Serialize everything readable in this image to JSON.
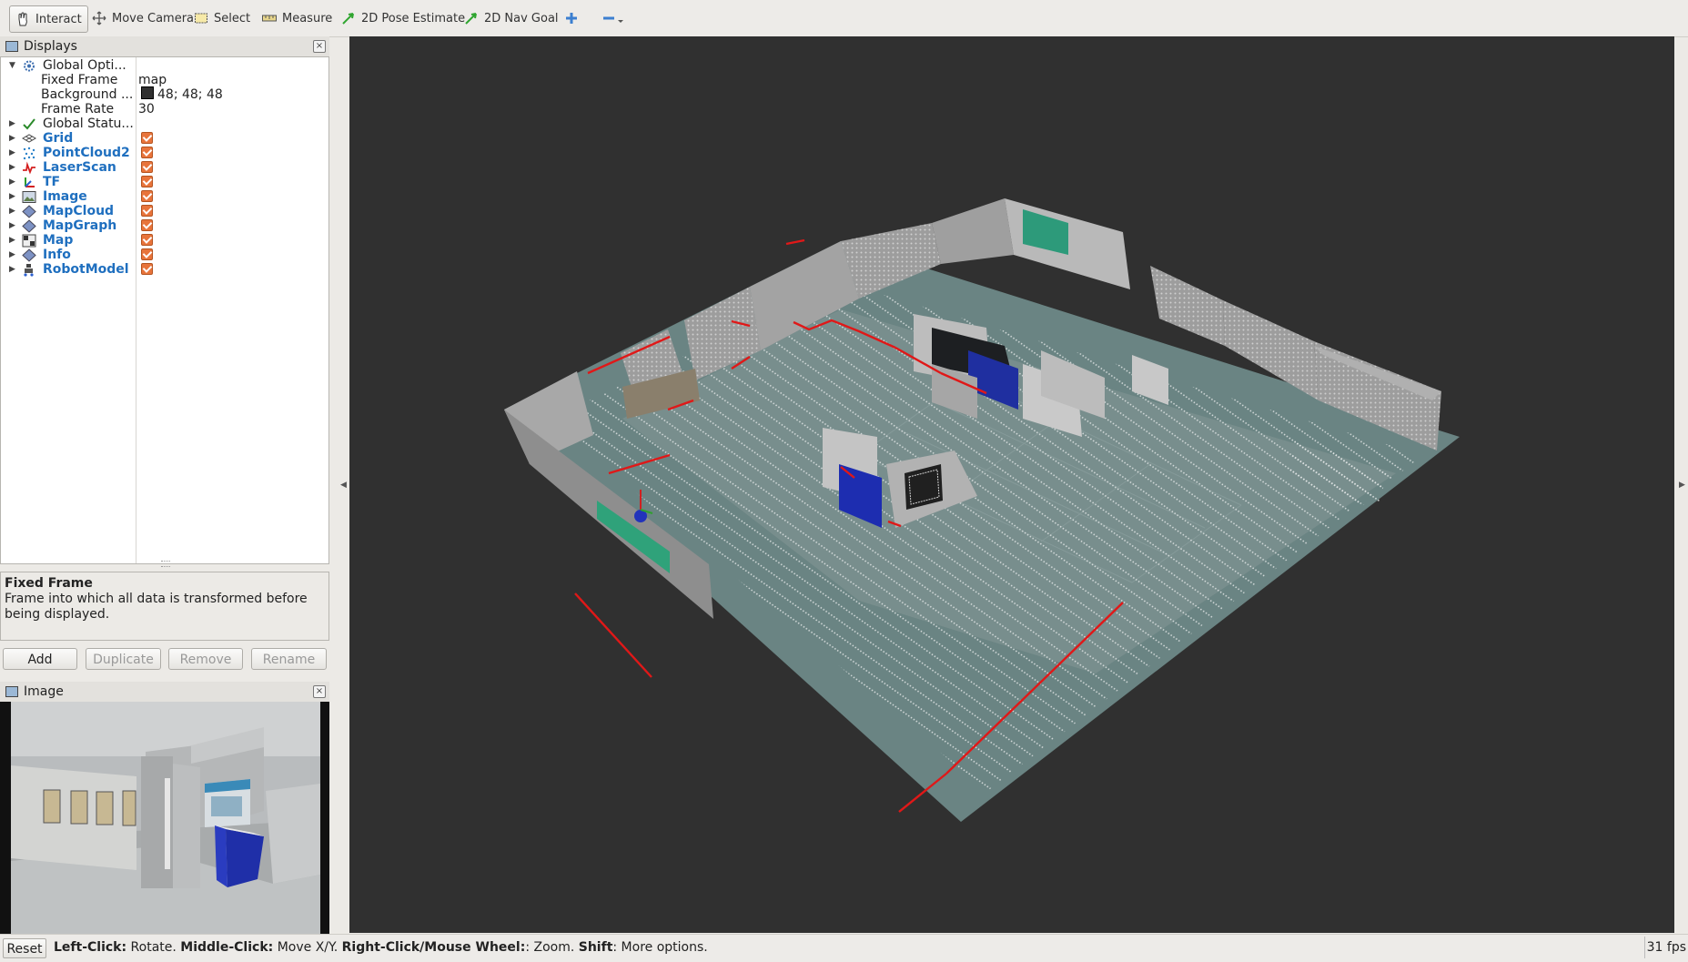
{
  "toolbar": {
    "tools": [
      {
        "label": "Interact",
        "icon": "hand-icon",
        "active": true
      },
      {
        "label": "Move Camera",
        "icon": "move-camera-icon"
      },
      {
        "label": "Select",
        "icon": "select-icon"
      },
      {
        "label": "Measure",
        "icon": "measure-icon"
      },
      {
        "label": "2D Pose Estimate",
        "icon": "pose-arrow-icon"
      },
      {
        "label": "2D Nav Goal",
        "icon": "nav-goal-arrow-icon"
      }
    ],
    "extra_icons": [
      "add-tool-icon",
      "remove-tool-icon"
    ]
  },
  "displays_panel": {
    "title": "Displays",
    "global_options": {
      "label": "Global Opti...",
      "fixed_frame_label": "Fixed Frame",
      "fixed_frame_value": "map",
      "background_label": "Background ...",
      "background_value": "48; 48; 48",
      "background_color": "#303030",
      "frame_rate_label": "Frame Rate",
      "frame_rate_value": "30"
    },
    "global_status_label": "Global Statu...",
    "displays": [
      {
        "label": "Grid",
        "icon": "grid-icon",
        "enabled": true
      },
      {
        "label": "PointCloud2",
        "icon": "pointcloud-icon",
        "enabled": true
      },
      {
        "label": "LaserScan",
        "icon": "laserscan-icon",
        "enabled": true
      },
      {
        "label": "TF",
        "icon": "tf-icon",
        "enabled": true
      },
      {
        "label": "Image",
        "icon": "image-icon",
        "enabled": true
      },
      {
        "label": "MapCloud",
        "icon": "mapcloud-icon",
        "enabled": true
      },
      {
        "label": "MapGraph",
        "icon": "mapgraph-icon",
        "enabled": true
      },
      {
        "label": "Map",
        "icon": "map-icon",
        "enabled": true
      },
      {
        "label": "Info",
        "icon": "info-icon",
        "enabled": true
      },
      {
        "label": "RobotModel",
        "icon": "robot-model-icon",
        "enabled": true
      }
    ],
    "description_title": "Fixed Frame",
    "description_text": "Frame into which all data is transformed before being displayed.",
    "buttons": {
      "add": "Add",
      "duplicate": "Duplicate",
      "remove": "Remove",
      "rename": "Rename"
    }
  },
  "image_panel": {
    "title": "Image"
  },
  "status_bar": {
    "reset": "Reset",
    "hint": [
      {
        "bold": "Left-Click:",
        "text": " Rotate. "
      },
      {
        "bold": "Middle-Click:",
        "text": " Move X/Y. "
      },
      {
        "bold": "Right-Click/Mouse Wheel:",
        "text": ": Zoom. "
      },
      {
        "bold": "Shift",
        "text": ": More options."
      }
    ],
    "fps": "31 fps"
  },
  "colors": {
    "accent_link": "#1f6fbf",
    "checkbox": "#e8743b",
    "laser": "#e02020",
    "grid_floor": "#6d8585"
  }
}
